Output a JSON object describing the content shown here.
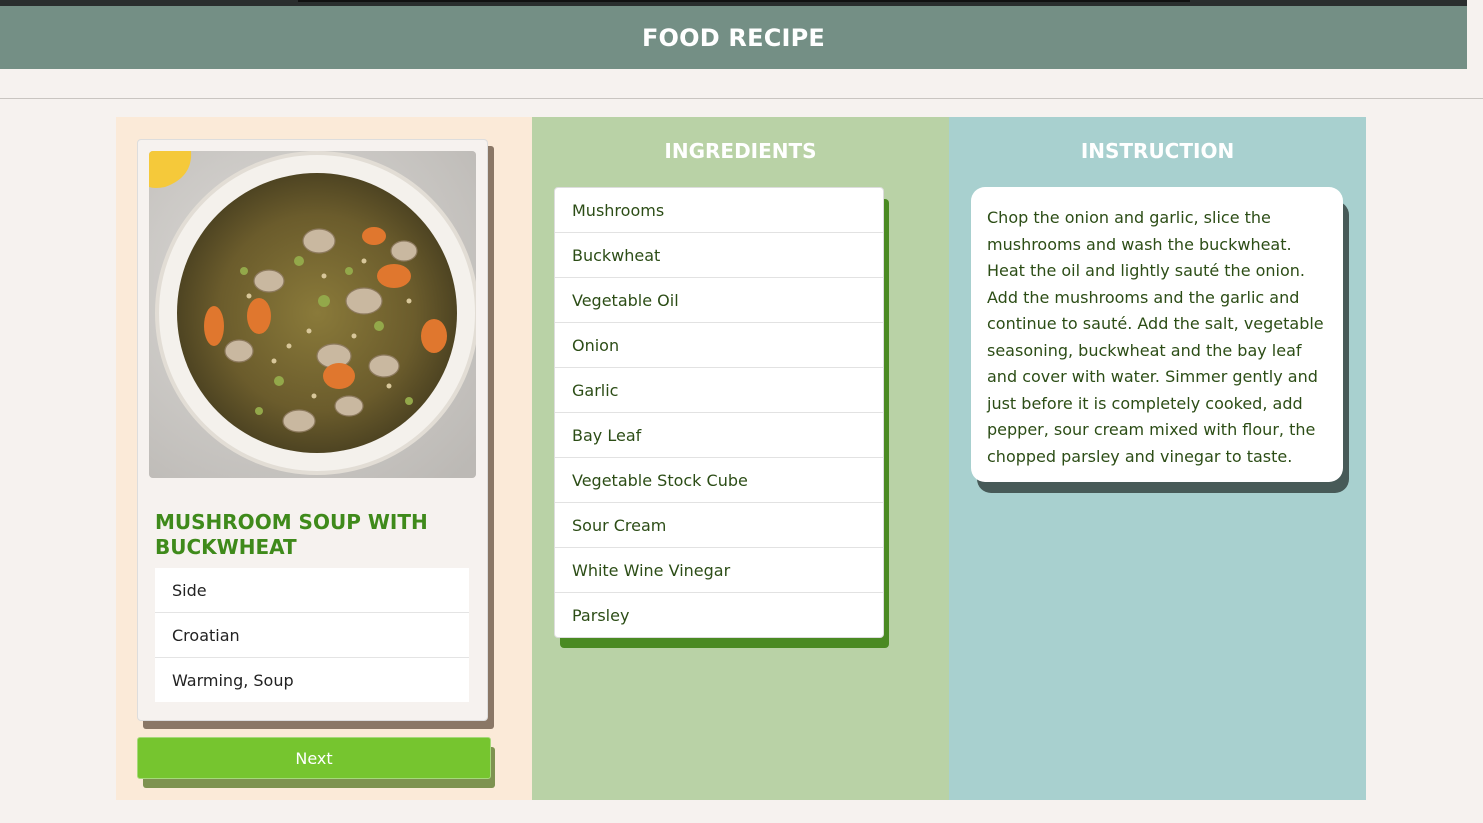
{
  "header": {
    "title": "FOOD RECIPE"
  },
  "recipe": {
    "name": "MUSHROOM SOUP WITH BUCKWHEAT",
    "category": "Side",
    "area": "Croatian",
    "tags": "Warming, Soup"
  },
  "buttons": {
    "next": "Next"
  },
  "ingredients": {
    "title": "INGREDIENTS",
    "items": [
      "Mushrooms",
      "Buckwheat",
      "Vegetable Oil",
      "Onion",
      "Garlic",
      "Bay Leaf",
      "Vegetable Stock Cube",
      "Sour Cream",
      "White Wine Vinegar",
      "Parsley"
    ]
  },
  "instruction": {
    "title": "INSTRUCTION",
    "text": "Chop the onion and garlic, slice the mushrooms and wash the buckwheat. Heat the oil and lightly sauté the onion. Add the mushrooms and the garlic and continue to sauté. Add the salt, vegetable seasoning, buckwheat and the bay leaf and cover with water. Simmer gently and just before it is completely cooked, add pepper, sour cream mixed with flour, the chopped parsley and vinegar to taste."
  },
  "colors": {
    "header": "#748f85",
    "left_panel": "#fbead8",
    "mid_panel": "#b9d2a6",
    "right_panel": "#a8d0cf",
    "accent_green": "#3f8a1b",
    "button": "#76c52f"
  }
}
